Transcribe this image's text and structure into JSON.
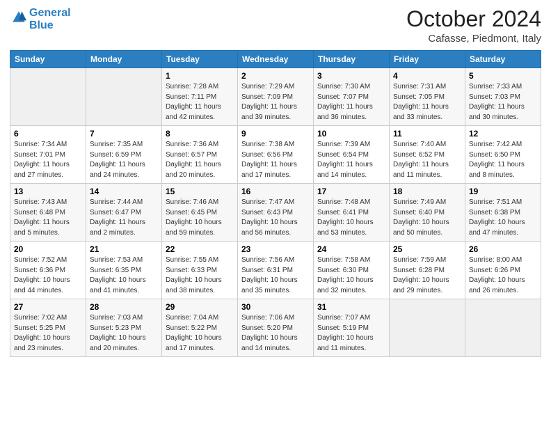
{
  "header": {
    "logo_line1": "General",
    "logo_line2": "Blue",
    "month": "October 2024",
    "location": "Cafasse, Piedmont, Italy"
  },
  "columns": [
    "Sunday",
    "Monday",
    "Tuesday",
    "Wednesday",
    "Thursday",
    "Friday",
    "Saturday"
  ],
  "weeks": [
    [
      {
        "day": "",
        "sunrise": "",
        "sunset": "",
        "daylight": ""
      },
      {
        "day": "",
        "sunrise": "",
        "sunset": "",
        "daylight": ""
      },
      {
        "day": "1",
        "sunrise": "Sunrise: 7:28 AM",
        "sunset": "Sunset: 7:11 PM",
        "daylight": "Daylight: 11 hours and 42 minutes."
      },
      {
        "day": "2",
        "sunrise": "Sunrise: 7:29 AM",
        "sunset": "Sunset: 7:09 PM",
        "daylight": "Daylight: 11 hours and 39 minutes."
      },
      {
        "day": "3",
        "sunrise": "Sunrise: 7:30 AM",
        "sunset": "Sunset: 7:07 PM",
        "daylight": "Daylight: 11 hours and 36 minutes."
      },
      {
        "day": "4",
        "sunrise": "Sunrise: 7:31 AM",
        "sunset": "Sunset: 7:05 PM",
        "daylight": "Daylight: 11 hours and 33 minutes."
      },
      {
        "day": "5",
        "sunrise": "Sunrise: 7:33 AM",
        "sunset": "Sunset: 7:03 PM",
        "daylight": "Daylight: 11 hours and 30 minutes."
      }
    ],
    [
      {
        "day": "6",
        "sunrise": "Sunrise: 7:34 AM",
        "sunset": "Sunset: 7:01 PM",
        "daylight": "Daylight: 11 hours and 27 minutes."
      },
      {
        "day": "7",
        "sunrise": "Sunrise: 7:35 AM",
        "sunset": "Sunset: 6:59 PM",
        "daylight": "Daylight: 11 hours and 24 minutes."
      },
      {
        "day": "8",
        "sunrise": "Sunrise: 7:36 AM",
        "sunset": "Sunset: 6:57 PM",
        "daylight": "Daylight: 11 hours and 20 minutes."
      },
      {
        "day": "9",
        "sunrise": "Sunrise: 7:38 AM",
        "sunset": "Sunset: 6:56 PM",
        "daylight": "Daylight: 11 hours and 17 minutes."
      },
      {
        "day": "10",
        "sunrise": "Sunrise: 7:39 AM",
        "sunset": "Sunset: 6:54 PM",
        "daylight": "Daylight: 11 hours and 14 minutes."
      },
      {
        "day": "11",
        "sunrise": "Sunrise: 7:40 AM",
        "sunset": "Sunset: 6:52 PM",
        "daylight": "Daylight: 11 hours and 11 minutes."
      },
      {
        "day": "12",
        "sunrise": "Sunrise: 7:42 AM",
        "sunset": "Sunset: 6:50 PM",
        "daylight": "Daylight: 11 hours and 8 minutes."
      }
    ],
    [
      {
        "day": "13",
        "sunrise": "Sunrise: 7:43 AM",
        "sunset": "Sunset: 6:48 PM",
        "daylight": "Daylight: 11 hours and 5 minutes."
      },
      {
        "day": "14",
        "sunrise": "Sunrise: 7:44 AM",
        "sunset": "Sunset: 6:47 PM",
        "daylight": "Daylight: 11 hours and 2 minutes."
      },
      {
        "day": "15",
        "sunrise": "Sunrise: 7:46 AM",
        "sunset": "Sunset: 6:45 PM",
        "daylight": "Daylight: 10 hours and 59 minutes."
      },
      {
        "day": "16",
        "sunrise": "Sunrise: 7:47 AM",
        "sunset": "Sunset: 6:43 PM",
        "daylight": "Daylight: 10 hours and 56 minutes."
      },
      {
        "day": "17",
        "sunrise": "Sunrise: 7:48 AM",
        "sunset": "Sunset: 6:41 PM",
        "daylight": "Daylight: 10 hours and 53 minutes."
      },
      {
        "day": "18",
        "sunrise": "Sunrise: 7:49 AM",
        "sunset": "Sunset: 6:40 PM",
        "daylight": "Daylight: 10 hours and 50 minutes."
      },
      {
        "day": "19",
        "sunrise": "Sunrise: 7:51 AM",
        "sunset": "Sunset: 6:38 PM",
        "daylight": "Daylight: 10 hours and 47 minutes."
      }
    ],
    [
      {
        "day": "20",
        "sunrise": "Sunrise: 7:52 AM",
        "sunset": "Sunset: 6:36 PM",
        "daylight": "Daylight: 10 hours and 44 minutes."
      },
      {
        "day": "21",
        "sunrise": "Sunrise: 7:53 AM",
        "sunset": "Sunset: 6:35 PM",
        "daylight": "Daylight: 10 hours and 41 minutes."
      },
      {
        "day": "22",
        "sunrise": "Sunrise: 7:55 AM",
        "sunset": "Sunset: 6:33 PM",
        "daylight": "Daylight: 10 hours and 38 minutes."
      },
      {
        "day": "23",
        "sunrise": "Sunrise: 7:56 AM",
        "sunset": "Sunset: 6:31 PM",
        "daylight": "Daylight: 10 hours and 35 minutes."
      },
      {
        "day": "24",
        "sunrise": "Sunrise: 7:58 AM",
        "sunset": "Sunset: 6:30 PM",
        "daylight": "Daylight: 10 hours and 32 minutes."
      },
      {
        "day": "25",
        "sunrise": "Sunrise: 7:59 AM",
        "sunset": "Sunset: 6:28 PM",
        "daylight": "Daylight: 10 hours and 29 minutes."
      },
      {
        "day": "26",
        "sunrise": "Sunrise: 8:00 AM",
        "sunset": "Sunset: 6:26 PM",
        "daylight": "Daylight: 10 hours and 26 minutes."
      }
    ],
    [
      {
        "day": "27",
        "sunrise": "Sunrise: 7:02 AM",
        "sunset": "Sunset: 5:25 PM",
        "daylight": "Daylight: 10 hours and 23 minutes."
      },
      {
        "day": "28",
        "sunrise": "Sunrise: 7:03 AM",
        "sunset": "Sunset: 5:23 PM",
        "daylight": "Daylight: 10 hours and 20 minutes."
      },
      {
        "day": "29",
        "sunrise": "Sunrise: 7:04 AM",
        "sunset": "Sunset: 5:22 PM",
        "daylight": "Daylight: 10 hours and 17 minutes."
      },
      {
        "day": "30",
        "sunrise": "Sunrise: 7:06 AM",
        "sunset": "Sunset: 5:20 PM",
        "daylight": "Daylight: 10 hours and 14 minutes."
      },
      {
        "day": "31",
        "sunrise": "Sunrise: 7:07 AM",
        "sunset": "Sunset: 5:19 PM",
        "daylight": "Daylight: 10 hours and 11 minutes."
      },
      {
        "day": "",
        "sunrise": "",
        "sunset": "",
        "daylight": ""
      },
      {
        "day": "",
        "sunrise": "",
        "sunset": "",
        "daylight": ""
      }
    ]
  ]
}
